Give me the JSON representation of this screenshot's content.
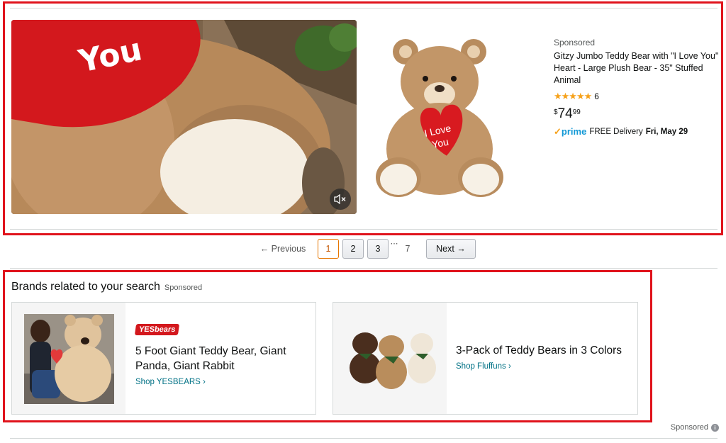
{
  "sponsored_product": {
    "sponsored_label": "Sponsored",
    "title": "Gitzy Jumbo Teddy Bear with \"I Love You\" Heart - Large Plush Bear - 35\" Stuffed Animal",
    "stars": "★★★★★",
    "rating_value": 5,
    "review_count": "6",
    "price_symbol": "$",
    "price_whole": "74",
    "price_fraction": "99",
    "prime_check": "✓",
    "prime_label": "prime",
    "delivery_text": "FREE Delivery",
    "delivery_date": "Fri, May 29",
    "video_overlay_text": "You",
    "product_heart_text_1": "I Love",
    "product_heart_text_2": "You"
  },
  "pagination": {
    "previous_label": "← Previous",
    "pages": [
      "1",
      "2",
      "3"
    ],
    "ellipsis": "⋯",
    "last_page": "7",
    "next_label": "Next →",
    "current_page": "1"
  },
  "brands": {
    "title": "Brands related to your search",
    "sponsored_label": "Sponsored",
    "cards": [
      {
        "logo_text": "YESbears",
        "title": "5 Foot Giant Teddy Bear, Giant Panda, Giant Rabbit",
        "shop_link": "Shop YESBEARS ›"
      },
      {
        "title": "3-Pack of Teddy Bears in 3 Colors",
        "shop_link": "Shop Fluffuns ›"
      }
    ]
  },
  "footer": {
    "sponsored_label": "Sponsored",
    "info_icon": "i"
  },
  "colors": {
    "highlight_red": "#e0131c",
    "link_teal": "#007185",
    "prime_blue": "#1399d6",
    "star_orange": "#f6a11a",
    "page_selected": "#e77600"
  }
}
